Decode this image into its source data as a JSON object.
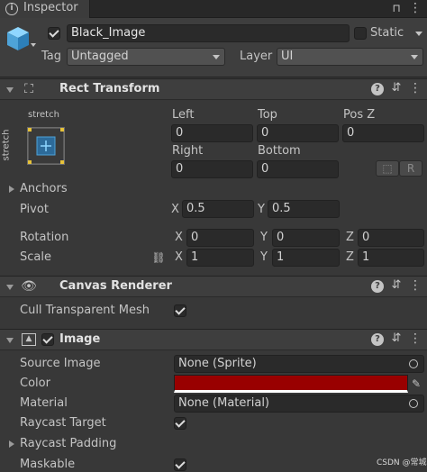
{
  "tab": {
    "title": "Inspector"
  },
  "header": {
    "name": "Black_Image",
    "static_label": "Static",
    "tag_label": "Tag",
    "tag_value": "Untagged",
    "layer_label": "Layer",
    "layer_value": "UI"
  },
  "rect_transform": {
    "title": "Rect Transform",
    "anchor_top": "stretch",
    "anchor_side": "stretch",
    "left_label": "Left",
    "left_value": "0",
    "top_label": "Top",
    "top_value": "0",
    "posz_label": "Pos Z",
    "posz_value": "0",
    "right_label": "Right",
    "right_value": "0",
    "bottom_label": "Bottom",
    "bottom_value": "0",
    "blueprint_btn": "⬚",
    "raw_btn": "R",
    "anchors_label": "Anchors",
    "pivot_label": "Pivot",
    "pivot": {
      "x_label": "X",
      "x": "0.5",
      "y_label": "Y",
      "y": "0.5"
    },
    "rotation_label": "Rotation",
    "rotation": {
      "x_label": "X",
      "x": "0",
      "y_label": "Y",
      "y": "0",
      "z_label": "Z",
      "z": "0"
    },
    "scale_label": "Scale",
    "scale": {
      "x_label": "X",
      "x": "1",
      "y_label": "Y",
      "y": "1",
      "z_label": "Z",
      "z": "1"
    }
  },
  "canvas_renderer": {
    "title": "Canvas Renderer",
    "cull_label": "Cull Transparent Mesh",
    "cull_checked": true
  },
  "image": {
    "title": "Image",
    "source_label": "Source Image",
    "source_value": "None (Sprite)",
    "color_label": "Color",
    "color_value": "#990000",
    "material_label": "Material",
    "material_value": "None (Material)",
    "raycast_label": "Raycast Target",
    "raycast_padding_label": "Raycast Padding",
    "maskable_label": "Maskable"
  },
  "watermark": "CSDN @常城",
  "colors": {
    "panel": "#383838",
    "header": "#3e3e3e",
    "field": "#2a2a2a",
    "accent": "#4ea3d8"
  }
}
